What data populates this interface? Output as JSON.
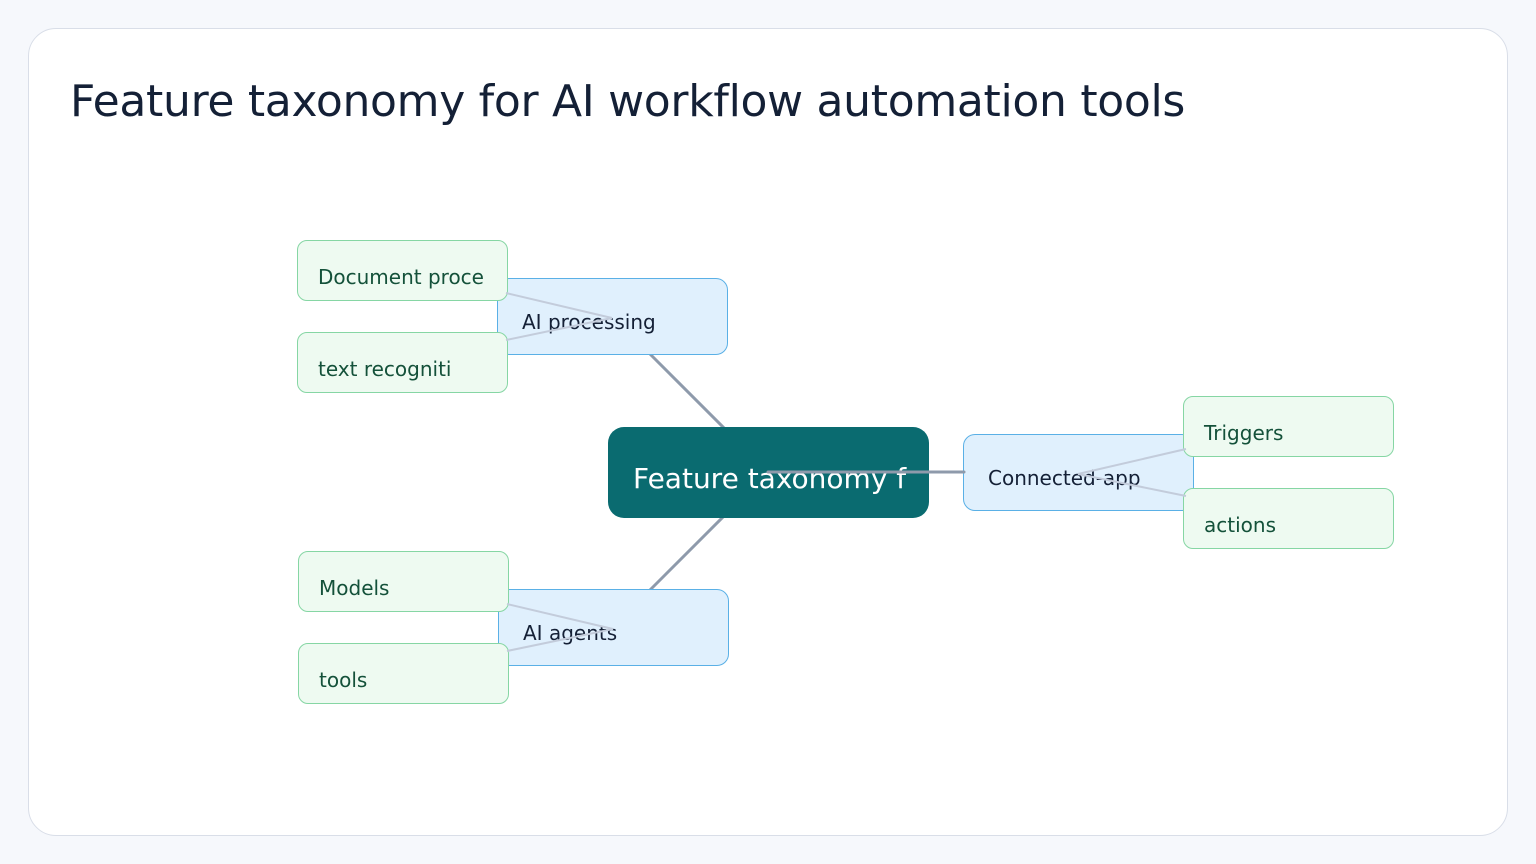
{
  "title": "Feature taxonomy for AI workflow automation tools",
  "colors": {
    "root_fill": "#0a6b70",
    "branch_fill": "#e0f0fd",
    "branch_border": "#5ab0e6",
    "leaf_fill": "#eefaf1",
    "leaf_border": "#86d6a4",
    "edge_main": "#8e9aab",
    "edge_leaf": "#c3ccdb"
  },
  "diagram": {
    "root": {
      "label": "Feature taxonomy f"
    },
    "branches": [
      {
        "label": "AI processing",
        "leaves": [
          {
            "label": "Document proce"
          },
          {
            "label": "text recogniti"
          }
        ]
      },
      {
        "label": "AI agents",
        "leaves": [
          {
            "label": "Models"
          },
          {
            "label": "tools"
          }
        ]
      },
      {
        "label": "Connected-app",
        "leaves": [
          {
            "label": "Triggers"
          },
          {
            "label": "actions"
          }
        ]
      }
    ]
  }
}
